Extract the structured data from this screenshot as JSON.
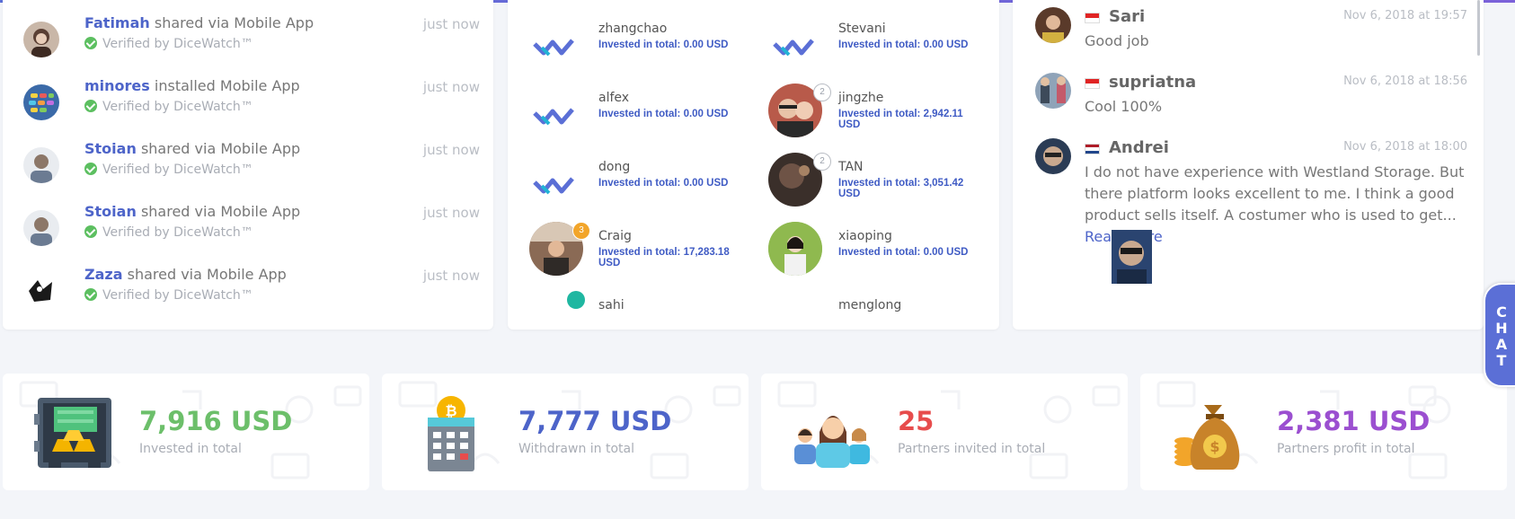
{
  "activity": [
    {
      "user": "Fatimah",
      "action": "shared via Mobile App",
      "verified": "Verified by DiceWatch™",
      "time": "just now",
      "avatar": "fatimah-avatar"
    },
    {
      "user": "minores",
      "action": "installed Mobile App",
      "verified": "Verified by DiceWatch™",
      "time": "just now",
      "avatar": "minores-avatar"
    },
    {
      "user": "Stoian",
      "action": "shared via Mobile App",
      "verified": "Verified by DiceWatch™",
      "time": "just now",
      "avatar": "stoian-avatar"
    },
    {
      "user": "Stoian",
      "action": "shared via Mobile App",
      "verified": "Verified by DiceWatch™",
      "time": "just now",
      "avatar": "stoian-avatar"
    },
    {
      "user": "Zaza",
      "action": "shared via Mobile App",
      "verified": "Verified by DiceWatch™",
      "time": "just now",
      "avatar": "zaza-avatar"
    }
  ],
  "investors": [
    {
      "name": "zhangchao",
      "amount": "Invested in total: 0.00 USD"
    },
    {
      "name": "Stevani",
      "amount": "Invested in total: 0.00 USD"
    },
    {
      "name": "alfex",
      "amount": "Invested in total: 0.00 USD"
    },
    {
      "name": "jingzhe",
      "amount": "Invested in total: 2,942.11 USD",
      "badge": "2"
    },
    {
      "name": "dong",
      "amount": "Invested in total: 0.00 USD"
    },
    {
      "name": "TAN",
      "amount": "Invested in total: 3,051.42 USD",
      "badge": "2"
    },
    {
      "name": "Craig",
      "amount": "Invested in total: 17,283.18 USD",
      "badge": "3"
    },
    {
      "name": "xiaoping",
      "amount": "Invested in total: 0.00 USD"
    },
    {
      "name": "sahi",
      "amount": ""
    },
    {
      "name": "menglong",
      "amount": ""
    }
  ],
  "comments": [
    {
      "name": "Sari",
      "date": "Nov 6, 2018 at 19:57",
      "text": "Good job",
      "flag": "Indonesia"
    },
    {
      "name": "supriatna",
      "date": "Nov 6, 2018 at 18:56",
      "text": "Cool 100%",
      "flag": "Indonesia"
    },
    {
      "name": "Andrei",
      "date": "Nov 6, 2018 at 18:00",
      "text": "I do not have experience with Westland Storage. But there platform looks excellent to me. I think a good product sells itself. A costumer who is used to get...",
      "read_more": "Read more",
      "flag": "Netherlands"
    }
  ],
  "stats": [
    {
      "value": "7,916 USD",
      "label": "Invested in total",
      "color": "#6cbf6a",
      "icon": "safe-with-cash-icon"
    },
    {
      "value": "7,777 USD",
      "label": "Withdrawn in total",
      "color": "#4d64c9",
      "icon": "bitcoin-atm-icon"
    },
    {
      "value": "25",
      "label": "Partners invited in total",
      "color": "#e74c4c",
      "icon": "partners-group-icon"
    },
    {
      "value": "2,381 USD",
      "label": "Partners profit in total",
      "color": "#9b4fd0",
      "icon": "money-bag-icon"
    }
  ],
  "chat": {
    "label": "CHAT"
  },
  "colors": {
    "accent": "#5b6fd6",
    "link": "#4d64c9",
    "verified": "#5cbf60"
  }
}
